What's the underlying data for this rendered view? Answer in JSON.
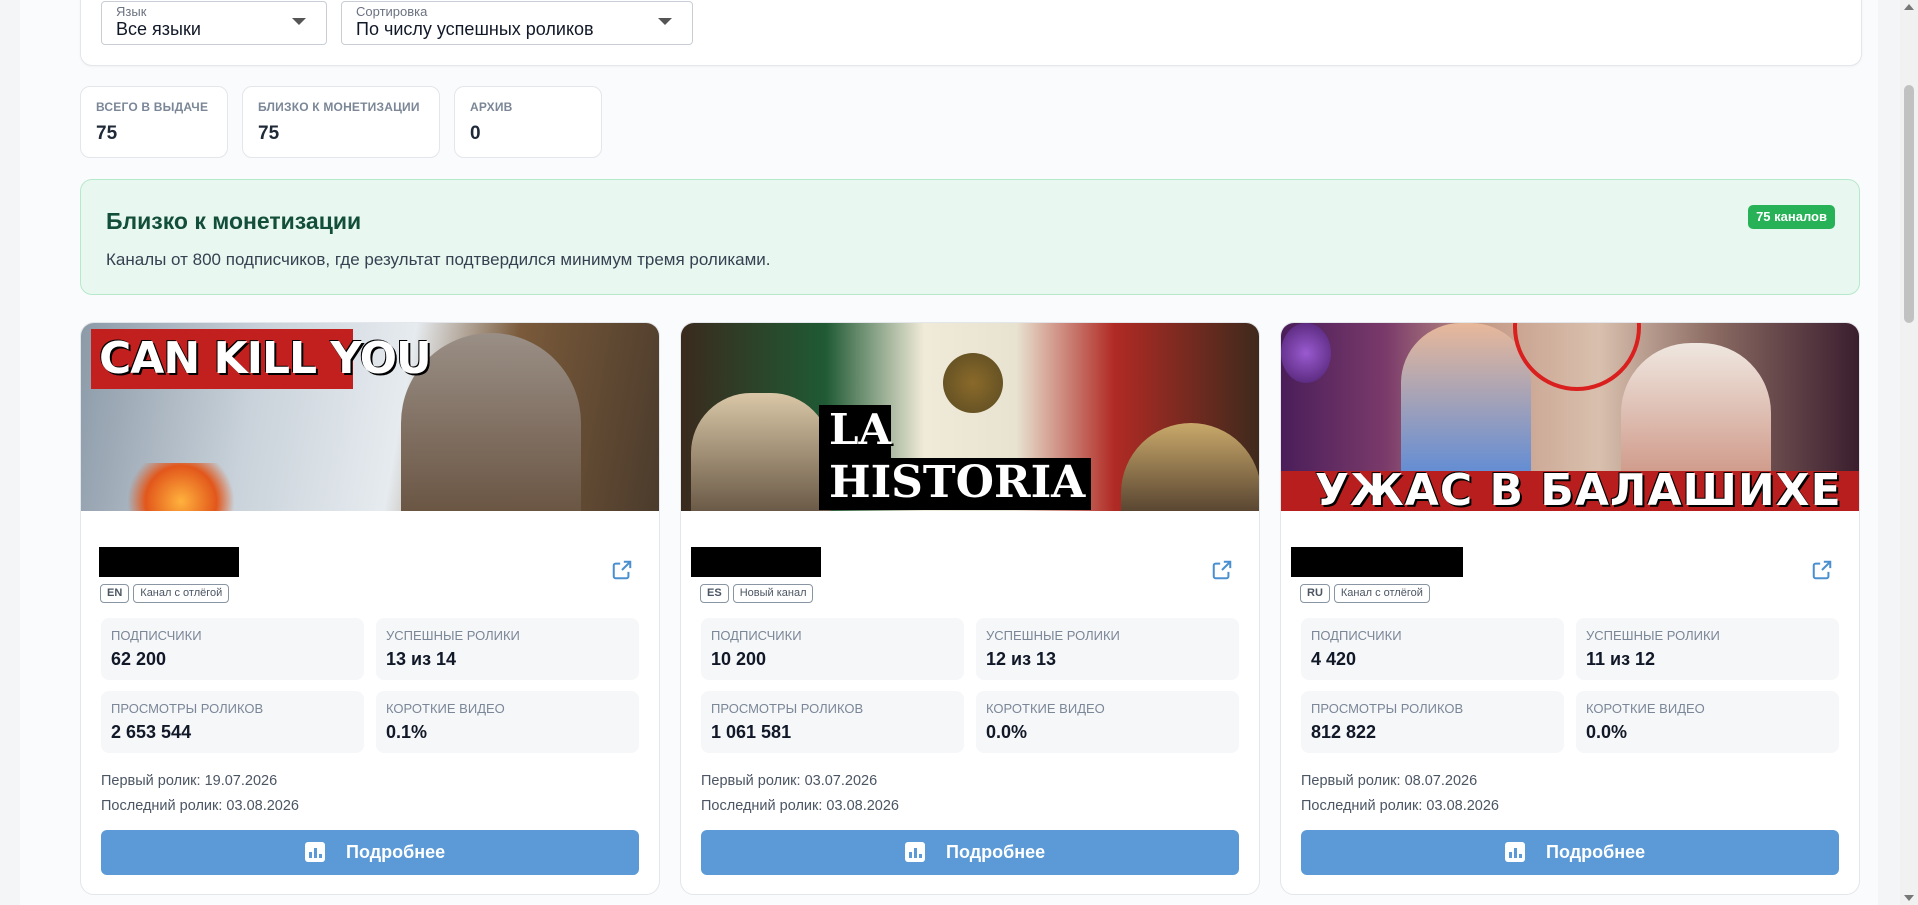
{
  "filters": {
    "language": {
      "label": "Язык",
      "value": "Все языки"
    },
    "sort": {
      "label": "Сортировка",
      "value": "По числу успешных роликов"
    }
  },
  "stats": [
    {
      "label": "ВСЕГО В ВЫДАЧЕ",
      "value": "75"
    },
    {
      "label": "БЛИЗКО К МОНЕТИЗАЦИИ",
      "value": "75"
    },
    {
      "label": "АРХИВ",
      "value": "0"
    }
  ],
  "banner": {
    "title": "Близко к монетизации",
    "description": "Каналы от 800 подписчиков, где результат подтвердился минимум тремя роликами.",
    "badge": "75 каналов"
  },
  "cards": [
    {
      "thumb_text": "CAN KILL YOU",
      "lang": "EN",
      "type": "Канал с отлёгой",
      "subscribers_label": "ПОДПИСЧИКИ",
      "subscribers": "62 200",
      "success_label": "УСПЕШНЫЕ РОЛИКИ",
      "success": "13 из 14",
      "views_label": "ПРОСМОТРЫ РОЛИКОВ",
      "views": "2 653 544",
      "shorts_label": "КОРОТКИЕ ВИДЕО",
      "shorts": "0.1%",
      "first": "Первый ролик: 19.07.2026",
      "last": "Последний ролик: 03.08.2026",
      "button": "Подробнее"
    },
    {
      "thumb_text_1": "LA",
      "thumb_text_2": "HISTORIA",
      "lang": "ES",
      "type": "Новый канал",
      "subscribers_label": "ПОДПИСЧИКИ",
      "subscribers": "10 200",
      "success_label": "УСПЕШНЫЕ РОЛИКИ",
      "success": "12 из 13",
      "views_label": "ПРОСМОТРЫ РОЛИКОВ",
      "views": "1 061 581",
      "shorts_label": "КОРОТКИЕ ВИДЕО",
      "shorts": "0.0%",
      "first": "Первый ролик: 03.07.2026",
      "last": "Последний ролик: 03.08.2026",
      "button": "Подробнее"
    },
    {
      "thumb_text": "УЖАС В БАЛАШИХЕ",
      "lang": "RU",
      "type": "Канал с отлёгой",
      "subscribers_label": "ПОДПИСЧИКИ",
      "subscribers": "4 420",
      "success_label": "УСПЕШНЫЕ РОЛИКИ",
      "success": "11 из 12",
      "views_label": "ПРОСМОТРЫ РОЛИКОВ",
      "views": "812 822",
      "shorts_label": "КОРОТКИЕ ВИДЕО",
      "shorts": "0.0%",
      "first": "Первый ролик: 08.07.2026",
      "last": "Последний ролик: 03.08.2026",
      "button": "Подробнее"
    }
  ],
  "colors": {
    "accent": "#5b9ad6",
    "success": "#27b258",
    "banner_bg": "#e8f8f0"
  }
}
